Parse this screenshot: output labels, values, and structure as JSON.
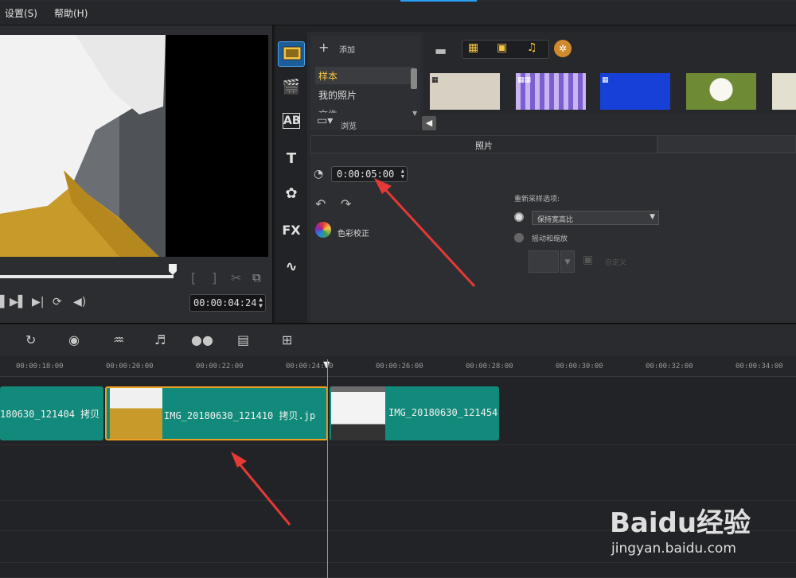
{
  "menu": {
    "settings": "设置(S)",
    "help": "帮助(H)"
  },
  "preview": {
    "timecode": "00:00:04:24"
  },
  "library": {
    "add_label": "添加",
    "folders": [
      "样本",
      "我的照片",
      "文件"
    ],
    "browse_label": "浏览"
  },
  "options": {
    "tab_photo": "照片",
    "duration": "0:00:05:00",
    "color_correction": "色彩校正",
    "resample_title": "重新采样选项:",
    "keep_aspect": "保持宽高比",
    "pan_zoom": "摇动和缩放",
    "customize": "自定义"
  },
  "timeline": {
    "ticks": [
      "00:00:18:00",
      "00:00:20:00",
      "00:00:22:00",
      "00:00:24:00",
      "00:00:26:00",
      "00:00:28:00",
      "00:00:30:00",
      "00:00:32:00",
      "00:00:34:00"
    ],
    "clips": [
      {
        "label": "180630_121404 拷贝"
      },
      {
        "label": "IMG_20180630_121410 拷贝.jp"
      },
      {
        "label": "IMG_20180630_121454"
      }
    ]
  },
  "watermark": {
    "brand": "Baidu经验",
    "url": "jingyan.baidu.com"
  },
  "colors": {
    "accent": "#2a9df4",
    "clip": "#128a7b",
    "arrow": "#e53935"
  }
}
